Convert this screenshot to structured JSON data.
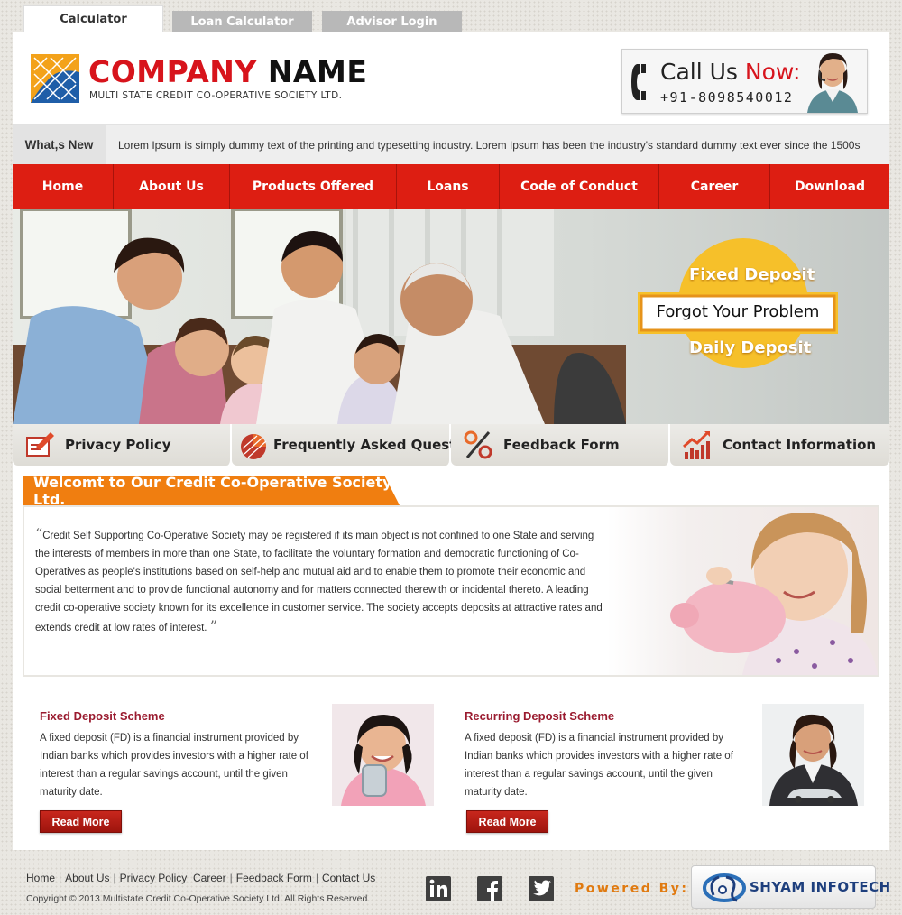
{
  "top_tabs": {
    "calculator": "Calculator",
    "loan_calculator": "Loan Calculator",
    "advisor_login": "Advisor Login"
  },
  "header": {
    "company_name_part1": "COMPANY",
    "company_name_part2": " NAME",
    "subtitle": "MULTI STATE CREDIT CO-OPERATIVE SOCIETY LTD.",
    "call_label_part1": "Call Us ",
    "call_label_part2": "Now:",
    "phone": "+91-8098540012"
  },
  "whats_new": {
    "label": "What,s New",
    "text": "Lorem Ipsum is simply dummy text of the printing and typesetting industry. Lorem Ipsum has been the industry's standard dummy text ever since the 1500s"
  },
  "nav": {
    "items": [
      "Home",
      "About Us",
      "Products Offered",
      "Loans",
      "Code of Conduct",
      "Career",
      "Download"
    ]
  },
  "banner": {
    "badge_top": "Fixed Deposit",
    "badge_middle": "Forgot Your Problem",
    "badge_bottom": "Daily Deposit"
  },
  "quick_links": [
    {
      "label": "Privacy Policy",
      "icon": "pen-document-icon"
    },
    {
      "label": "Frequently Asked Questions",
      "icon": "pie-chart-icon"
    },
    {
      "label": "Feedback Form",
      "icon": "percent-icon"
    },
    {
      "label": "Contact Information",
      "icon": "growth-chart-icon"
    }
  ],
  "welcome": {
    "title": "Welcomt to Our Credit Co-Operative Society Ltd.",
    "body": "Credit Self Supporting Co-Operative Society may be registered if its main object is not confined to one State and serving the interests of members in more than one State, to facilitate the voluntary formation and democratic functioning of Co-Operatives as people's institutions based on self-help and mutual aid and to enable them to promote their economic and social betterment and to provide functional autonomy and for matters connected therewith or incidental thereto. A leading credit co-operative society known for its excellence in customer service. The society accepts deposits at attractive rates and extends credit at low rates of interest.",
    "open_quote": "“",
    "close_quote": "”"
  },
  "schemes": [
    {
      "title": "Fixed Deposit Scheme",
      "text": "A fixed deposit (FD) is a financial instrument provided by Indian banks which provides investors with a higher rate of interest than a regular savings account, until the given maturity date.",
      "button": "Read More"
    },
    {
      "title": "Recurring Deposit Scheme",
      "text": "A fixed deposit (FD) is a financial instrument provided by Indian banks which provides investors with a higher rate of interest than a regular savings account, until the given maturity date.",
      "button": "Read More"
    }
  ],
  "footer": {
    "links": [
      "Home",
      "About Us",
      "Privacy Policy",
      "Career",
      "Feedback Form",
      "Contact Us"
    ],
    "copyright": "Copyright © 2013 Multistate Credit Co-Operative Society Ltd. All Rights Reserved.",
    "social_icons": [
      "linkedin-icon",
      "facebook-icon",
      "twitter-icon"
    ],
    "powered_by": "Powered By:",
    "brand": "SHYAM INFOTECH"
  },
  "colors": {
    "brand_red": "#dd1e12",
    "accent_orange": "#f07e10",
    "scheme_title": "#9a1b2f"
  }
}
